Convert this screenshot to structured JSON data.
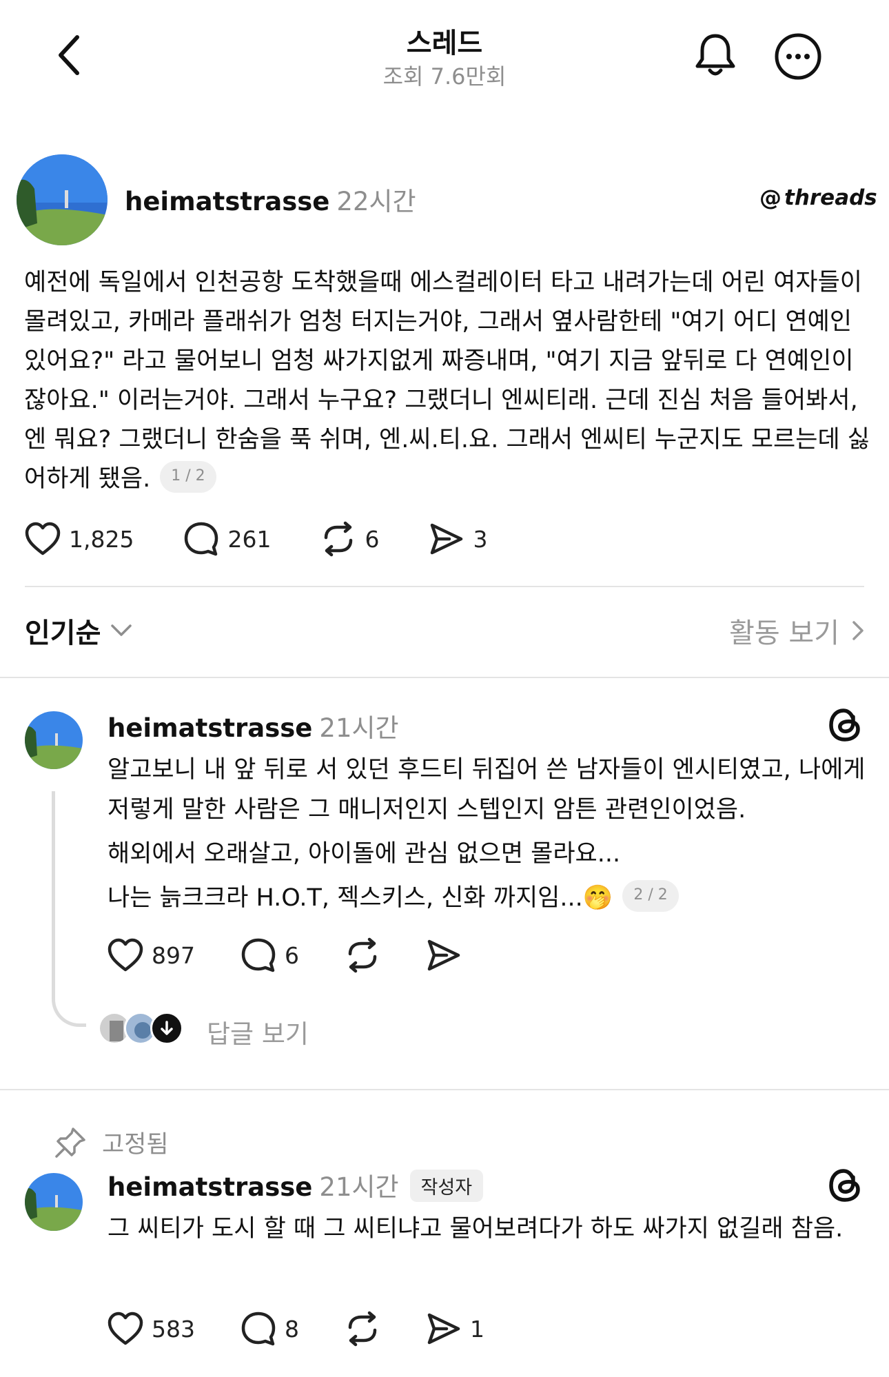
{
  "header": {
    "title": "스레드",
    "views": "조회 7.6만회"
  },
  "post": {
    "username": "heimatstrasse",
    "time": "22시간",
    "brand": "threads",
    "text": "예전에 독일에서 인천공항 도착했을때 에스컬레이터 타고 내려가는데 어린 여자들이 몰려있고, 카메라 플래쉬가 엄청 터지는거야, 그래서 옆사람한테 \"여기 어디 연예인 있어요?\" 라고 물어보니 엄청 싸가지없게 짜증내며, \"여기 지금 앞뒤로 다 연예인이잖아요.\" 이러는거야. 그래서 누구요? 그랬더니 엔씨티래. 근데 진심 처음 들어봐서, 엔 뭐요? 그랬더니 한숨을 푹 쉬며, 엔.씨.티.요. 그래서 엔씨티 누군지도 모르는데 싫어하게 됐음.",
    "pager": "1 / 2",
    "likes": "1,825",
    "comments": "261",
    "reposts": "6",
    "shares": "3"
  },
  "sort": {
    "label": "인기순",
    "activity_label": "활동 보기"
  },
  "reply1": {
    "username": "heimatstrasse",
    "time": "21시간",
    "p1": "알고보니 내 앞 뒤로 서 있던 후드티 뒤집어 쓴 남자들이 엔시티였고, 나에게 저렇게 말한 사람은 그 매니저인지 스텝인지 암튼 관련인이었음.",
    "p2": "해외에서 오래살고, 아이돌에 관심 없으면 몰라요...",
    "p3": "나는 늙크크라 H.O.T, 젝스키스, 신화 까지임...",
    "emoji": "🤭",
    "pager": "2 / 2",
    "likes": "897",
    "comments": "6",
    "view_replies": "답글 보기"
  },
  "reply2": {
    "pinned_label": "고정됨",
    "username": "heimatstrasse",
    "time": "21시간",
    "badge": "작성자",
    "text": "그 씨티가 도시 할 때 그 씨티냐고 물어보려다가 하도 싸가지 없길래 참음.",
    "likes": "583",
    "comments": "8",
    "shares": "1"
  },
  "icons": {
    "back": "chevron-left-icon",
    "bell": "bell-icon",
    "more": "more-icon",
    "like": "heart-icon",
    "comment": "comment-icon",
    "repost": "repost-icon",
    "share": "send-icon",
    "threads": "threads-icon",
    "pin": "pin-icon"
  }
}
